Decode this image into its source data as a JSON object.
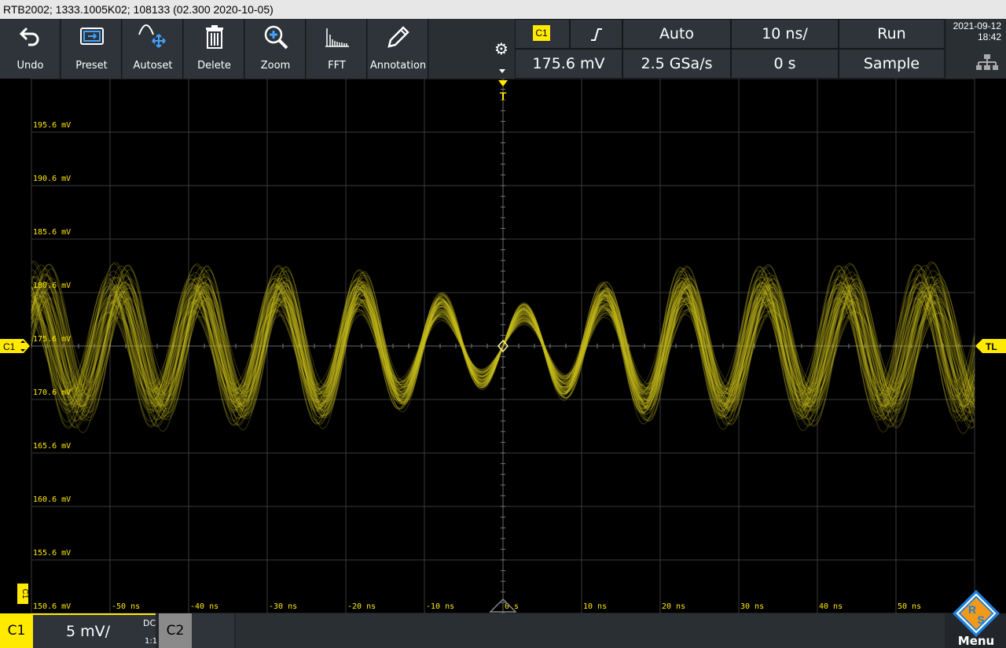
{
  "titlebar": {
    "text": "RTB2002; 1333.1005K02; 108133 (02.300 2020-10-05)"
  },
  "toolbar": {
    "undo": "Undo",
    "preset": "Preset",
    "autoset": "Autoset",
    "delete": "Delete",
    "zoom": "Zoom",
    "fft": "FFT",
    "annotation": "Annotation"
  },
  "trigger": {
    "source": "C1",
    "level": "175.6 mV",
    "mode": "Auto",
    "timebase": "10 ns/",
    "sample_rate": "2.5 GSa/s",
    "position": "0 s",
    "state": "Run",
    "acq_mode": "Sample"
  },
  "datetime": {
    "date": "2021-09-12",
    "time": "18:42"
  },
  "plot": {
    "y_ticks": [
      "195.6 mV",
      "190.6 mV",
      "185.6 mV",
      "180.6 mV",
      "175.6 mV",
      "170.6 mV",
      "165.6 mV",
      "160.6 mV",
      "155.6 mV",
      "150.6 mV"
    ],
    "x_ticks": [
      "-50 ns",
      "-40 ns",
      "-30 ns",
      "-20 ns",
      "-10 ns",
      "0 s",
      "10 ns",
      "20 ns",
      "30 ns",
      "40 ns",
      "50 ns"
    ],
    "left_marker": "C1",
    "right_marker": "TL",
    "top_marker": "T",
    "channel_label": "C1",
    "colors": {
      "trace": "#c8bf1e",
      "accent": "#ffea00",
      "grid": "#3a3a3a"
    }
  },
  "bottom": {
    "c1_tab": "C1",
    "c1_scale": "5 mV/",
    "c1_coupling": "DC",
    "c1_probe": "1:1",
    "c2_tab": "C2",
    "menu": "Menu"
  }
}
